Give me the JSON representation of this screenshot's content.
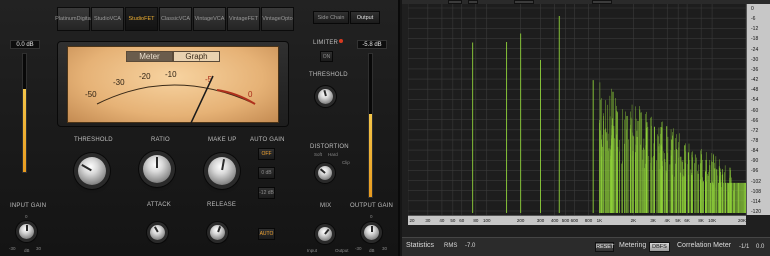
{
  "compressor": {
    "models": [
      {
        "line1": "Platinum",
        "line2": "Digital",
        "active": false
      },
      {
        "line1": "Studio",
        "line2": "VCA",
        "active": false
      },
      {
        "line1": "Studio",
        "line2": "FET",
        "active": true
      },
      {
        "line1": "Classic",
        "line2": "VCA",
        "active": false
      },
      {
        "line1": "Vintage",
        "line2": "VCA",
        "active": false
      },
      {
        "line1": "Vintage",
        "line2": "FET",
        "active": false
      },
      {
        "line1": "Vintage",
        "line2": "Opto",
        "active": false
      }
    ],
    "side_chain_label": "Side Chain",
    "output_label": "Output",
    "meter": {
      "tab_meter": "Meter",
      "tab_graph": "Graph",
      "active_tab": "Meter",
      "scale": [
        "-50",
        "-30",
        "-20",
        "-10",
        "-5",
        "0"
      ]
    },
    "input_meter_readout": "0.0 dB",
    "output_meter_readout": "-5.8 dB",
    "input_meter_level": 0.7,
    "output_meter_level": 0.58,
    "labels": {
      "threshold": "THRESHOLD",
      "ratio": "RATIO",
      "makeup": "MAKE UP",
      "auto_gain": "AUTO GAIN",
      "input_gain": "INPUT GAIN",
      "attack": "ATTACK",
      "release": "RELEASE",
      "limiter": "LIMITER",
      "limiter_threshold": "THRESHOLD",
      "distortion": "DISTORTION",
      "mix": "MIX",
      "output_gain": "OUTPUT GAIN"
    },
    "buttons": {
      "auto_gain_off": "OFF",
      "auto_gain_0db": "0 dB",
      "auto_gain_12db": "-12 dB",
      "auto_release": "AUTO",
      "limiter_on": "ON"
    },
    "distortion_modes": {
      "soft": "Soft",
      "hard": "Hard",
      "clip": "Clip"
    },
    "mix_ends": {
      "input": "Input",
      "output": "Output"
    },
    "input_gain_ticks": {
      "top": "0",
      "left": "-30",
      "right": "30",
      "unit": "dB"
    },
    "output_gain_ticks": {
      "top": "0",
      "left": "-30",
      "right": "30",
      "unit": "dB"
    }
  },
  "analyzer": {
    "y_ticks": [
      "0",
      "-6",
      "-12",
      "-18",
      "-24",
      "-30",
      "-36",
      "-42",
      "-48",
      "-54",
      "-60",
      "-66",
      "-72",
      "-78",
      "-84",
      "-90",
      "-96",
      "-102",
      "-108",
      "-114",
      "-120"
    ],
    "x_ticks": [
      "20",
      "30",
      "40",
      "50",
      "60",
      "80",
      "100",
      "200",
      "300",
      "400",
      "500",
      "600",
      "800",
      "1K",
      "2K",
      "3K",
      "4K",
      "5K",
      "6K",
      "8K",
      "10K",
      "20K"
    ],
    "colors": {
      "grid": "#3a3a3a",
      "spectrum": "#8fd13a",
      "background": "#1d1d1d"
    },
    "status": {
      "statistics_label": "Statistics",
      "rms_label": "RMS",
      "rms_value": "-7.0",
      "reset_label": "RESET",
      "metering_label": "Metering",
      "metering_mode": "DBFS",
      "correlation_label": "Correlation Meter",
      "corr_left": "-1/1",
      "corr_value": "0.0"
    }
  }
}
